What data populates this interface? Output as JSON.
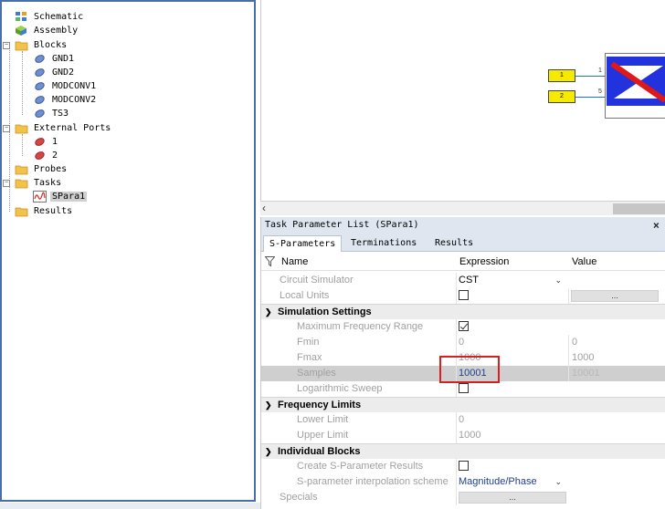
{
  "tree": {
    "items": [
      {
        "label": "Schematic",
        "icon": "schematic-icon"
      },
      {
        "label": "Assembly",
        "icon": "assembly-icon"
      },
      {
        "label": "Blocks",
        "icon": "folder-icon"
      },
      {
        "label": "GND1",
        "icon": "block-icon"
      },
      {
        "label": "GND2",
        "icon": "block-icon"
      },
      {
        "label": "MODCONV1",
        "icon": "block-icon"
      },
      {
        "label": "MODCONV2",
        "icon": "block-icon"
      },
      {
        "label": "TS3",
        "icon": "block-icon"
      },
      {
        "label": "External Ports",
        "icon": "folder-icon"
      },
      {
        "label": "1",
        "icon": "port-icon"
      },
      {
        "label": "2",
        "icon": "port-icon"
      },
      {
        "label": "Probes",
        "icon": "folder-icon"
      },
      {
        "label": "Tasks",
        "icon": "folder-icon"
      },
      {
        "label": "SPara1",
        "icon": "sparam-task-icon"
      },
      {
        "label": "Results",
        "icon": "folder-icon"
      }
    ]
  },
  "canvas": {
    "ports": [
      {
        "label": "1",
        "pin": "1"
      },
      {
        "label": "2",
        "pin": "5"
      }
    ]
  },
  "param_panel": {
    "title": "Task Parameter List (SPara1)",
    "close": "×",
    "tabs": [
      "S-Parameters",
      "Terminations",
      "Results"
    ],
    "headers": {
      "name": "Name",
      "expression": "Expression",
      "value": "Value"
    },
    "rows": {
      "circuit_simulator": {
        "name": "Circuit Simulator",
        "expression": "CST"
      },
      "local_units": {
        "name": "Local Units",
        "value_button": "..."
      },
      "simulation_settings": {
        "name": "Simulation Settings"
      },
      "max_freq_range": {
        "name": "Maximum Frequency Range"
      },
      "fmin": {
        "name": "Fmin",
        "expression": "0",
        "value": "0"
      },
      "fmax": {
        "name": "Fmax",
        "expression": "1000",
        "value": "1000"
      },
      "samples": {
        "name": "Samples",
        "expression": "10001",
        "value": "10001"
      },
      "log_sweep": {
        "name": "Logarithmic Sweep"
      },
      "frequency_limits": {
        "name": "Frequency Limits"
      },
      "lower_limit": {
        "name": "Lower Limit",
        "expression": "0"
      },
      "upper_limit": {
        "name": "Upper Limit",
        "expression": "1000"
      },
      "individual_blocks": {
        "name": "Individual Blocks"
      },
      "create_sparam": {
        "name": "Create S-Parameter Results"
      },
      "interp_scheme": {
        "name": "S-parameter interpolation scheme",
        "expression": "Magnitude/Phase"
      },
      "specials": {
        "name": "Specials",
        "expression_button": "..."
      }
    }
  },
  "colors": {
    "port_fill": "#f5ea00",
    "highlight_border": "#d91e1e",
    "panel_border": "#4a6fa8"
  }
}
